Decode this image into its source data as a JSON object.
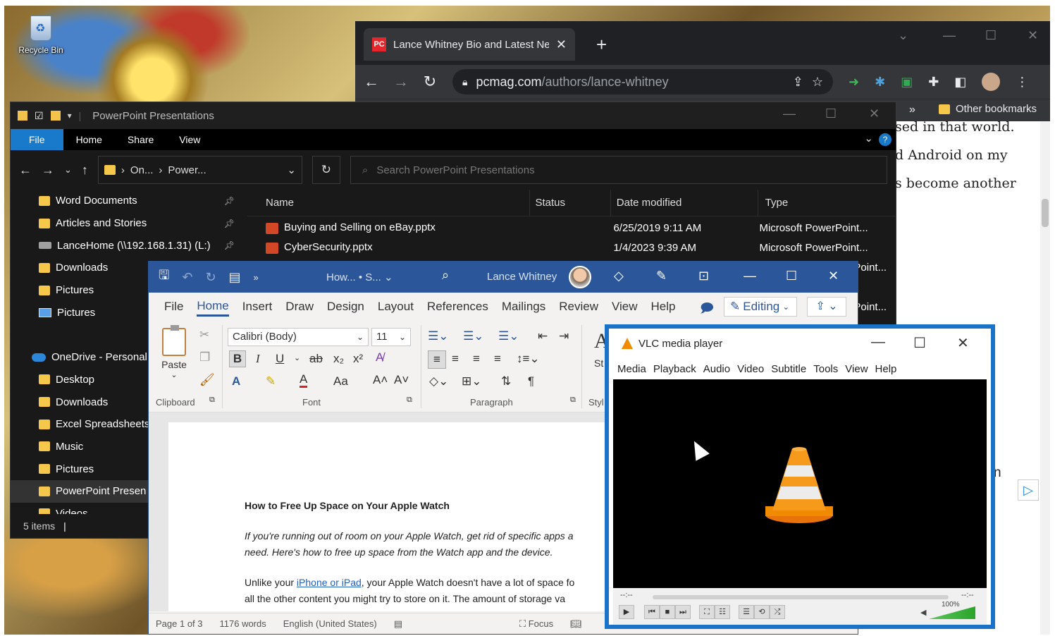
{
  "desktop": {
    "recycle_bin": "Recycle Bin"
  },
  "chrome": {
    "tab_title": "Lance Whitney Bio and Latest Ne",
    "tab_favicon": "PC",
    "url_domain": "pcmag.com",
    "url_path": "/authors/lance-whitney",
    "bookmarks_overflow": "»",
    "other_bookmarks": "Other bookmarks",
    "article_lines": [
      "sed in that world.",
      "d Android on my",
      "s become another"
    ],
    "partial_letter": "n"
  },
  "explorer": {
    "title": "PowerPoint Presentations",
    "ribbon_tabs": [
      "File",
      "Home",
      "Share",
      "View"
    ],
    "breadcrumb": [
      "On...",
      "Power..."
    ],
    "search_placeholder": "Search PowerPoint Presentations",
    "nav_items": [
      {
        "label": "Word Documents",
        "pinned": true
      },
      {
        "label": "Articles and Stories",
        "pinned": true
      },
      {
        "label": "LanceHome (\\\\192.168.1.31) (L:)",
        "pinned": true
      },
      {
        "label": "Downloads"
      },
      {
        "label": "Pictures"
      },
      {
        "label": "Pictures"
      },
      {
        "label": ""
      },
      {
        "label": "OneDrive - Personal"
      },
      {
        "label": "Desktop"
      },
      {
        "label": "Downloads"
      },
      {
        "label": "Excel Spreadsheets"
      },
      {
        "label": "Music"
      },
      {
        "label": "Pictures"
      },
      {
        "label": "PowerPoint Presen"
      },
      {
        "label": "Videos"
      }
    ],
    "columns": [
      "Name",
      "Status",
      "Date modified",
      "Type"
    ],
    "files": [
      {
        "name": "Buying and Selling on eBay.pptx",
        "status": "",
        "date": "6/25/2019 9:11 AM",
        "type": "Microsoft PowerPoint..."
      },
      {
        "name": "CyberSecurity.pptx",
        "status": "",
        "date": "1/4/2023 9:39 AM",
        "type": "Microsoft PowerPoint..."
      },
      {
        "name": "",
        "status": "",
        "date": "",
        "type": "Point..."
      },
      {
        "name": "",
        "status": "",
        "date": "",
        "type": ""
      },
      {
        "name": "",
        "status": "",
        "date": "",
        "type": "Point..."
      }
    ],
    "status": "5 items"
  },
  "word": {
    "title": "How... • S...",
    "user": "Lance Whitney",
    "tabs": [
      "File",
      "Home",
      "Insert",
      "Draw",
      "Design",
      "Layout",
      "References",
      "Mailings",
      "Review",
      "View",
      "Help"
    ],
    "editing": "Editing",
    "font_name": "Calibri (Body)",
    "font_size": "11",
    "paste_label": "Paste",
    "groups": {
      "clipboard": "Clipboard",
      "font": "Font",
      "paragraph": "Paragraph",
      "styles": "Styl"
    },
    "styles_partial": "St",
    "doc": {
      "heading": "How to Free Up Space on Your Apple Watch",
      "intro_1": "If you're running out of room on your Apple Watch, get rid of specific apps a",
      "intro_2": "need. Here's how to free up space from the Watch app and the device.",
      "body_prefix": "Unlike your ",
      "body_link": "iPhone or iPad",
      "body_rest": ", your Apple Watch doesn't have a lot of space fo",
      "body_2": "all the other content you might try to store on it. The amount of storage va"
    },
    "status": {
      "page": "Page 1 of 3",
      "words": "1176 words",
      "language": "English (United States)",
      "focus": "Focus"
    }
  },
  "vlc": {
    "title": "VLC media player",
    "menu": [
      "Media",
      "Playback",
      "Audio",
      "Video",
      "Subtitle",
      "Tools",
      "View",
      "Help"
    ],
    "time_left": "--:--",
    "time_right": "--:--",
    "volume": "100%"
  }
}
